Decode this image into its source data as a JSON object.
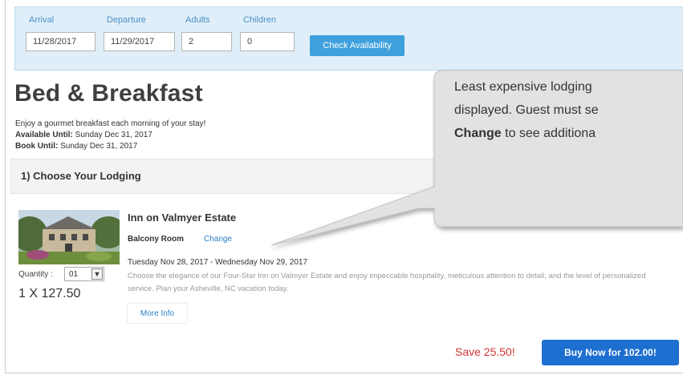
{
  "search": {
    "arrival_label": "Arrival",
    "arrival_value": "11/28/2017",
    "departure_label": "Departure",
    "departure_value": "11/29/2017",
    "adults_label": "Adults",
    "adults_value": "2",
    "children_label": "Children",
    "children_value": "0",
    "check_button": "Check Availability"
  },
  "package": {
    "title": "Bed & Breakfast",
    "description": "Enjoy a gourmet breakfast each morning of your stay!",
    "available_label": "Available Until:",
    "available_value": " Sunday Dec 31, 2017",
    "book_label": "Book Until:",
    "book_value": " Sunday Dec 31, 2017"
  },
  "section": {
    "title": "1) Choose Your Lodging"
  },
  "lodging": {
    "name": "Inn on Valmyer Estate",
    "room": "Balcony Room",
    "change_link": "Change",
    "dates": "Tuesday Nov 28, 2017 - Wednesday Nov 29, 2017",
    "description": "Choose the elegance of our Four-Star Inn on Valmyer Estate and enjoy impeccable hospitality, meticulous attention to detail, and the level of personalized service. Plan your Asheville, NC vacation today.",
    "quantity_label": "Quantity :",
    "quantity_value": "01",
    "price_line": "1 X 127.50",
    "more_info": "More Info"
  },
  "footer": {
    "save_text": "Save 25.50!",
    "buy_button": "Buy Now for 102.00!"
  },
  "callout": {
    "line1": "Least expensive lodging",
    "line2": "displayed. Guest must se",
    "line3_bold": "Change",
    "line3_rest": " to see additiona"
  },
  "colors": {
    "accent": "#3ea0dc",
    "buy": "#1d6fd0",
    "save": "#d23232",
    "link": "#2a7fc4"
  }
}
